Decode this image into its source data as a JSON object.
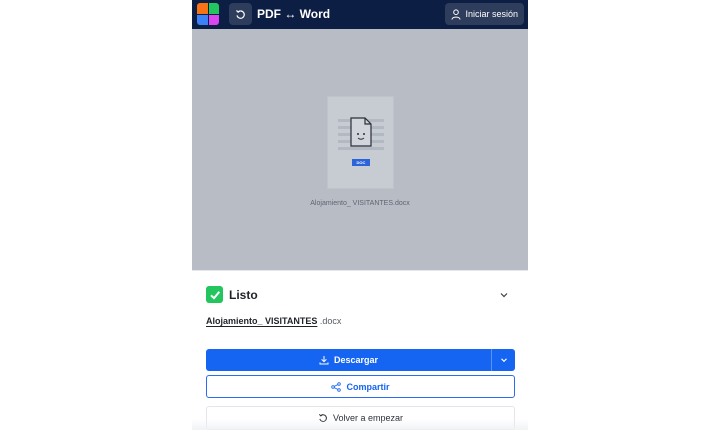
{
  "header": {
    "logo_colors": [
      "#f97316",
      "#22c55e",
      "#3b82f6",
      "#d946ef"
    ],
    "back_icon": "undo-icon",
    "title": "PDF ↔ Word",
    "login_label": "Iniciar sesión",
    "login_icon": "user-icon"
  },
  "preview": {
    "badge": "DOC",
    "file_name": "Alojamiento_ VISITANTES.docx"
  },
  "result": {
    "status": "Listo",
    "file_base": "Alojamiento_ VISITANTES",
    "file_ext": ".docx",
    "download_label": "Descargar",
    "share_label": "Compartir",
    "restart_label": "Volver a empezar"
  },
  "colors": {
    "topbar": "#0d1e44",
    "primary": "#1565f2",
    "success": "#22c55e",
    "overlay": "#b7bcc5"
  }
}
